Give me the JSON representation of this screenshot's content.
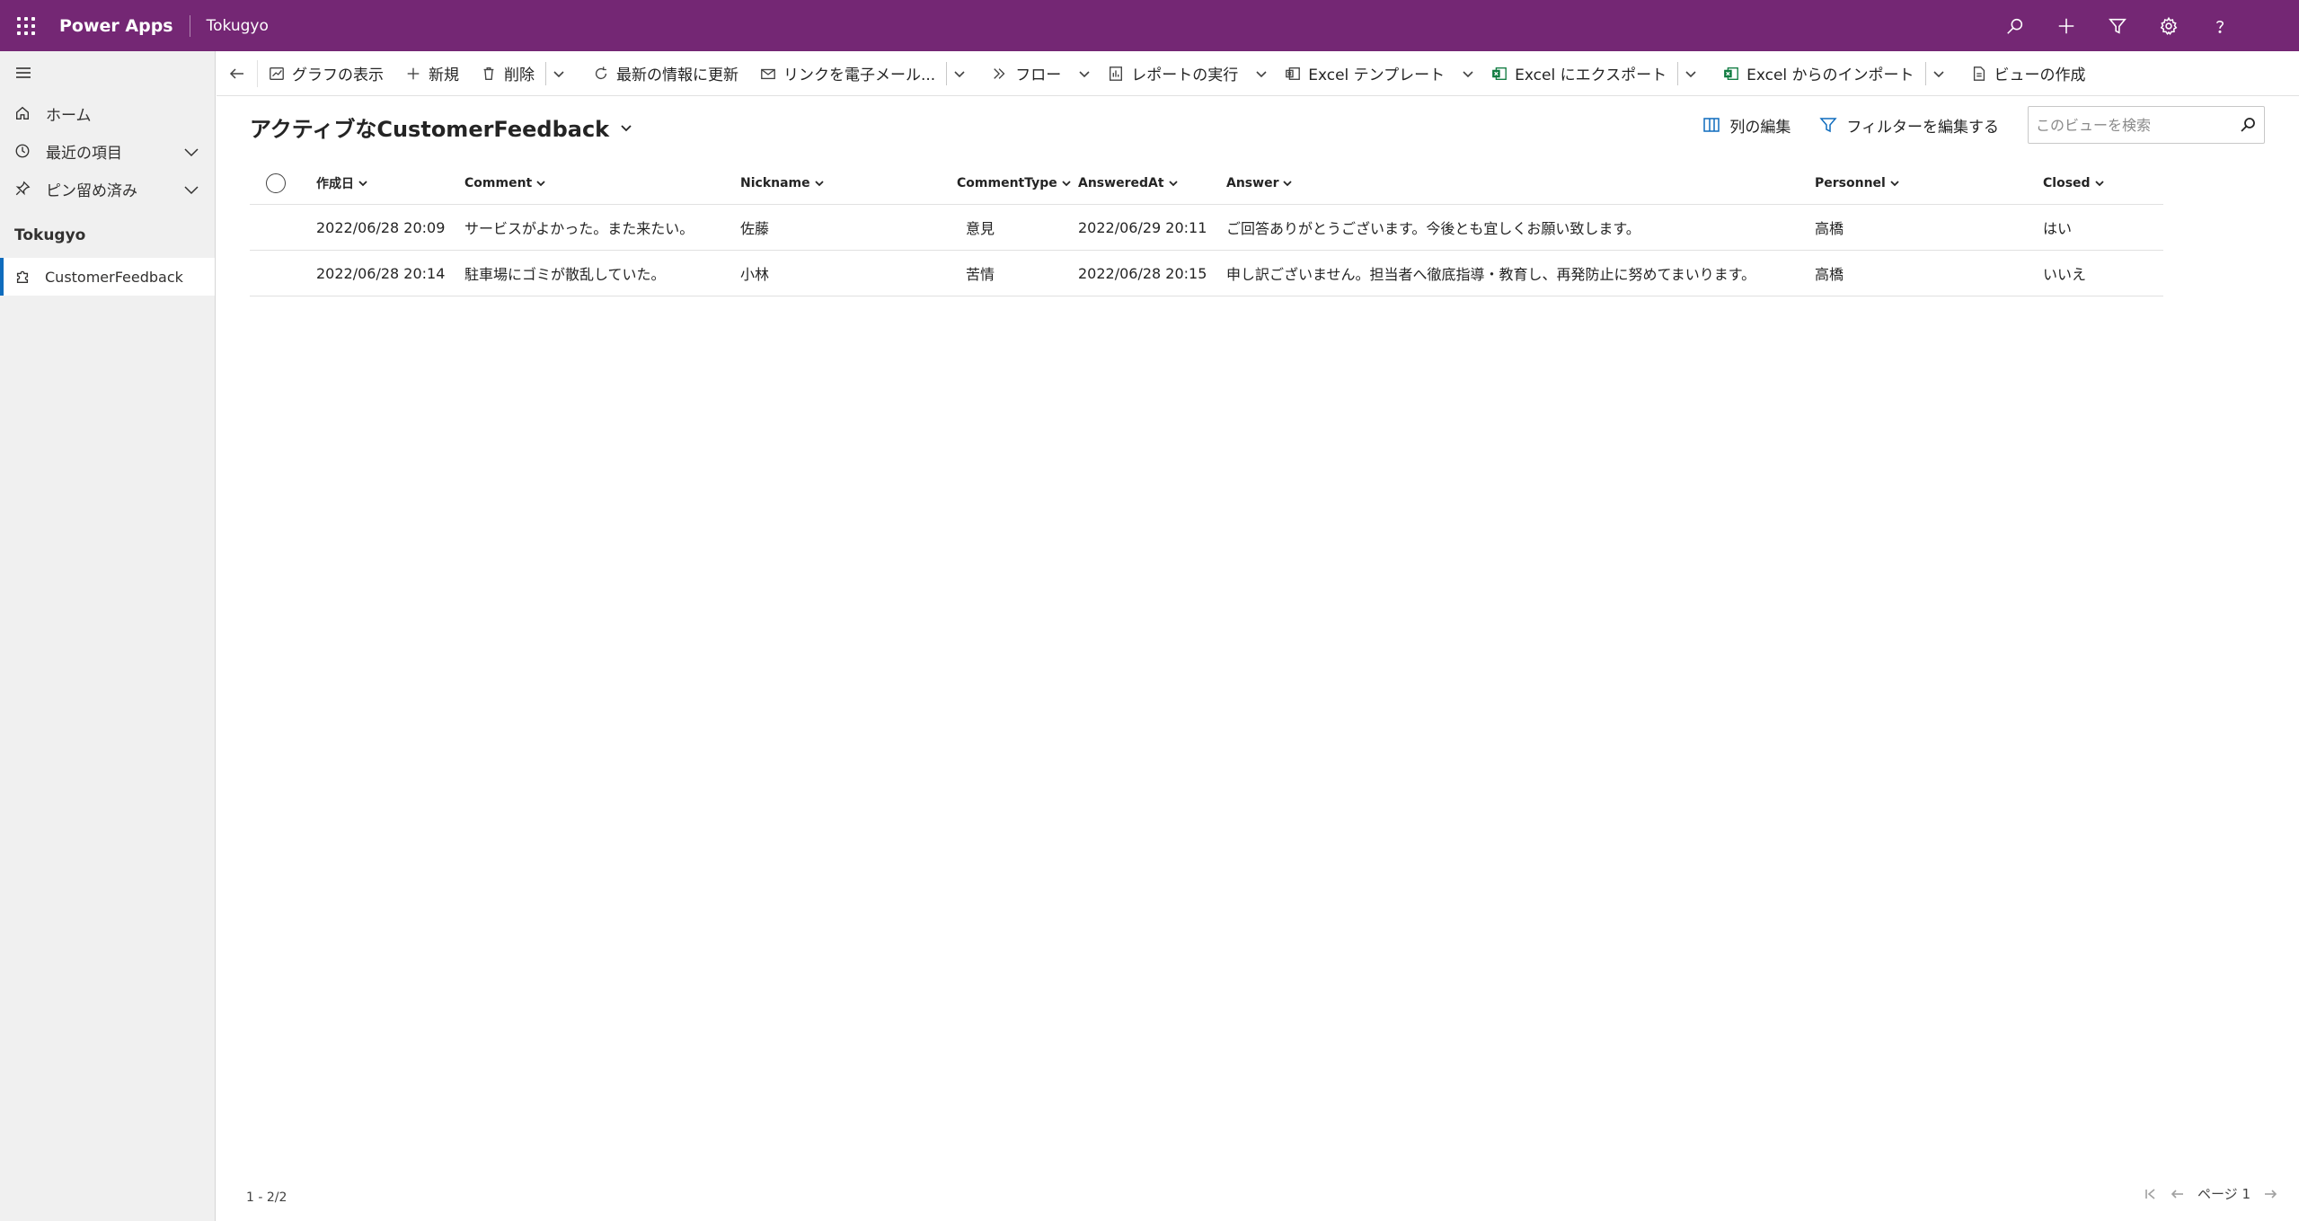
{
  "topbar": {
    "app_name": "Power Apps",
    "environment": "Tokugyo",
    "icons": [
      "search-icon",
      "plus-icon",
      "filter-icon",
      "gear-icon",
      "help-icon"
    ]
  },
  "sidebar": {
    "items": [
      {
        "label": "ホーム",
        "icon": "home-icon"
      },
      {
        "label": "最近の項目",
        "icon": "clock-icon"
      },
      {
        "label": "ピン留め済み",
        "icon": "pin-icon"
      }
    ],
    "group_label": "Tokugyo",
    "entity": {
      "label": "CustomerFeedback",
      "icon": "puzzle-icon"
    }
  },
  "commandbar": {
    "chart": "グラフの表示",
    "new": "新規",
    "delete": "削除",
    "refresh": "最新の情報に更新",
    "email_link": "リンクを電子メール...",
    "flow": "フロー",
    "run_report": "レポートの実行",
    "excel_template": "Excel テンプレート",
    "export_excel": "Excel にエクスポート",
    "import_excel": "Excel からのインポート",
    "create_view": "ビューの作成"
  },
  "view": {
    "title": "アクティブなCustomerFeedback",
    "edit_columns": "列の編集",
    "edit_filters": "フィルターを編集する",
    "search_placeholder": "このビューを検索"
  },
  "grid": {
    "columns": [
      "作成日",
      "Comment",
      "Nickname",
      "CommentType",
      "AnsweredAt",
      "Answer",
      "Personnel",
      "Closed"
    ],
    "rows": [
      [
        "2022/06/28 20:09",
        "サービスがよかった。また来たい。",
        "佐藤",
        "意見",
        "2022/06/29 20:11",
        "ご回答ありがとうございます。今後とも宜しくお願い致します。",
        "高橋",
        "はい"
      ],
      [
        "2022/06/28 20:14",
        "駐車場にゴミが散乱していた。",
        "小林",
        "苦情",
        "2022/06/28 20:15",
        "申し訳ございません。担当者へ徹底指導・教育し、再発防止に努めてまいります。",
        "高橋",
        "いいえ"
      ]
    ]
  },
  "footer": {
    "count": "1 - 2/2",
    "page": "ページ 1"
  },
  "colors": {
    "topbar": "#742774",
    "accent": "#0f6cbd",
    "excel_green": "#107c41"
  }
}
